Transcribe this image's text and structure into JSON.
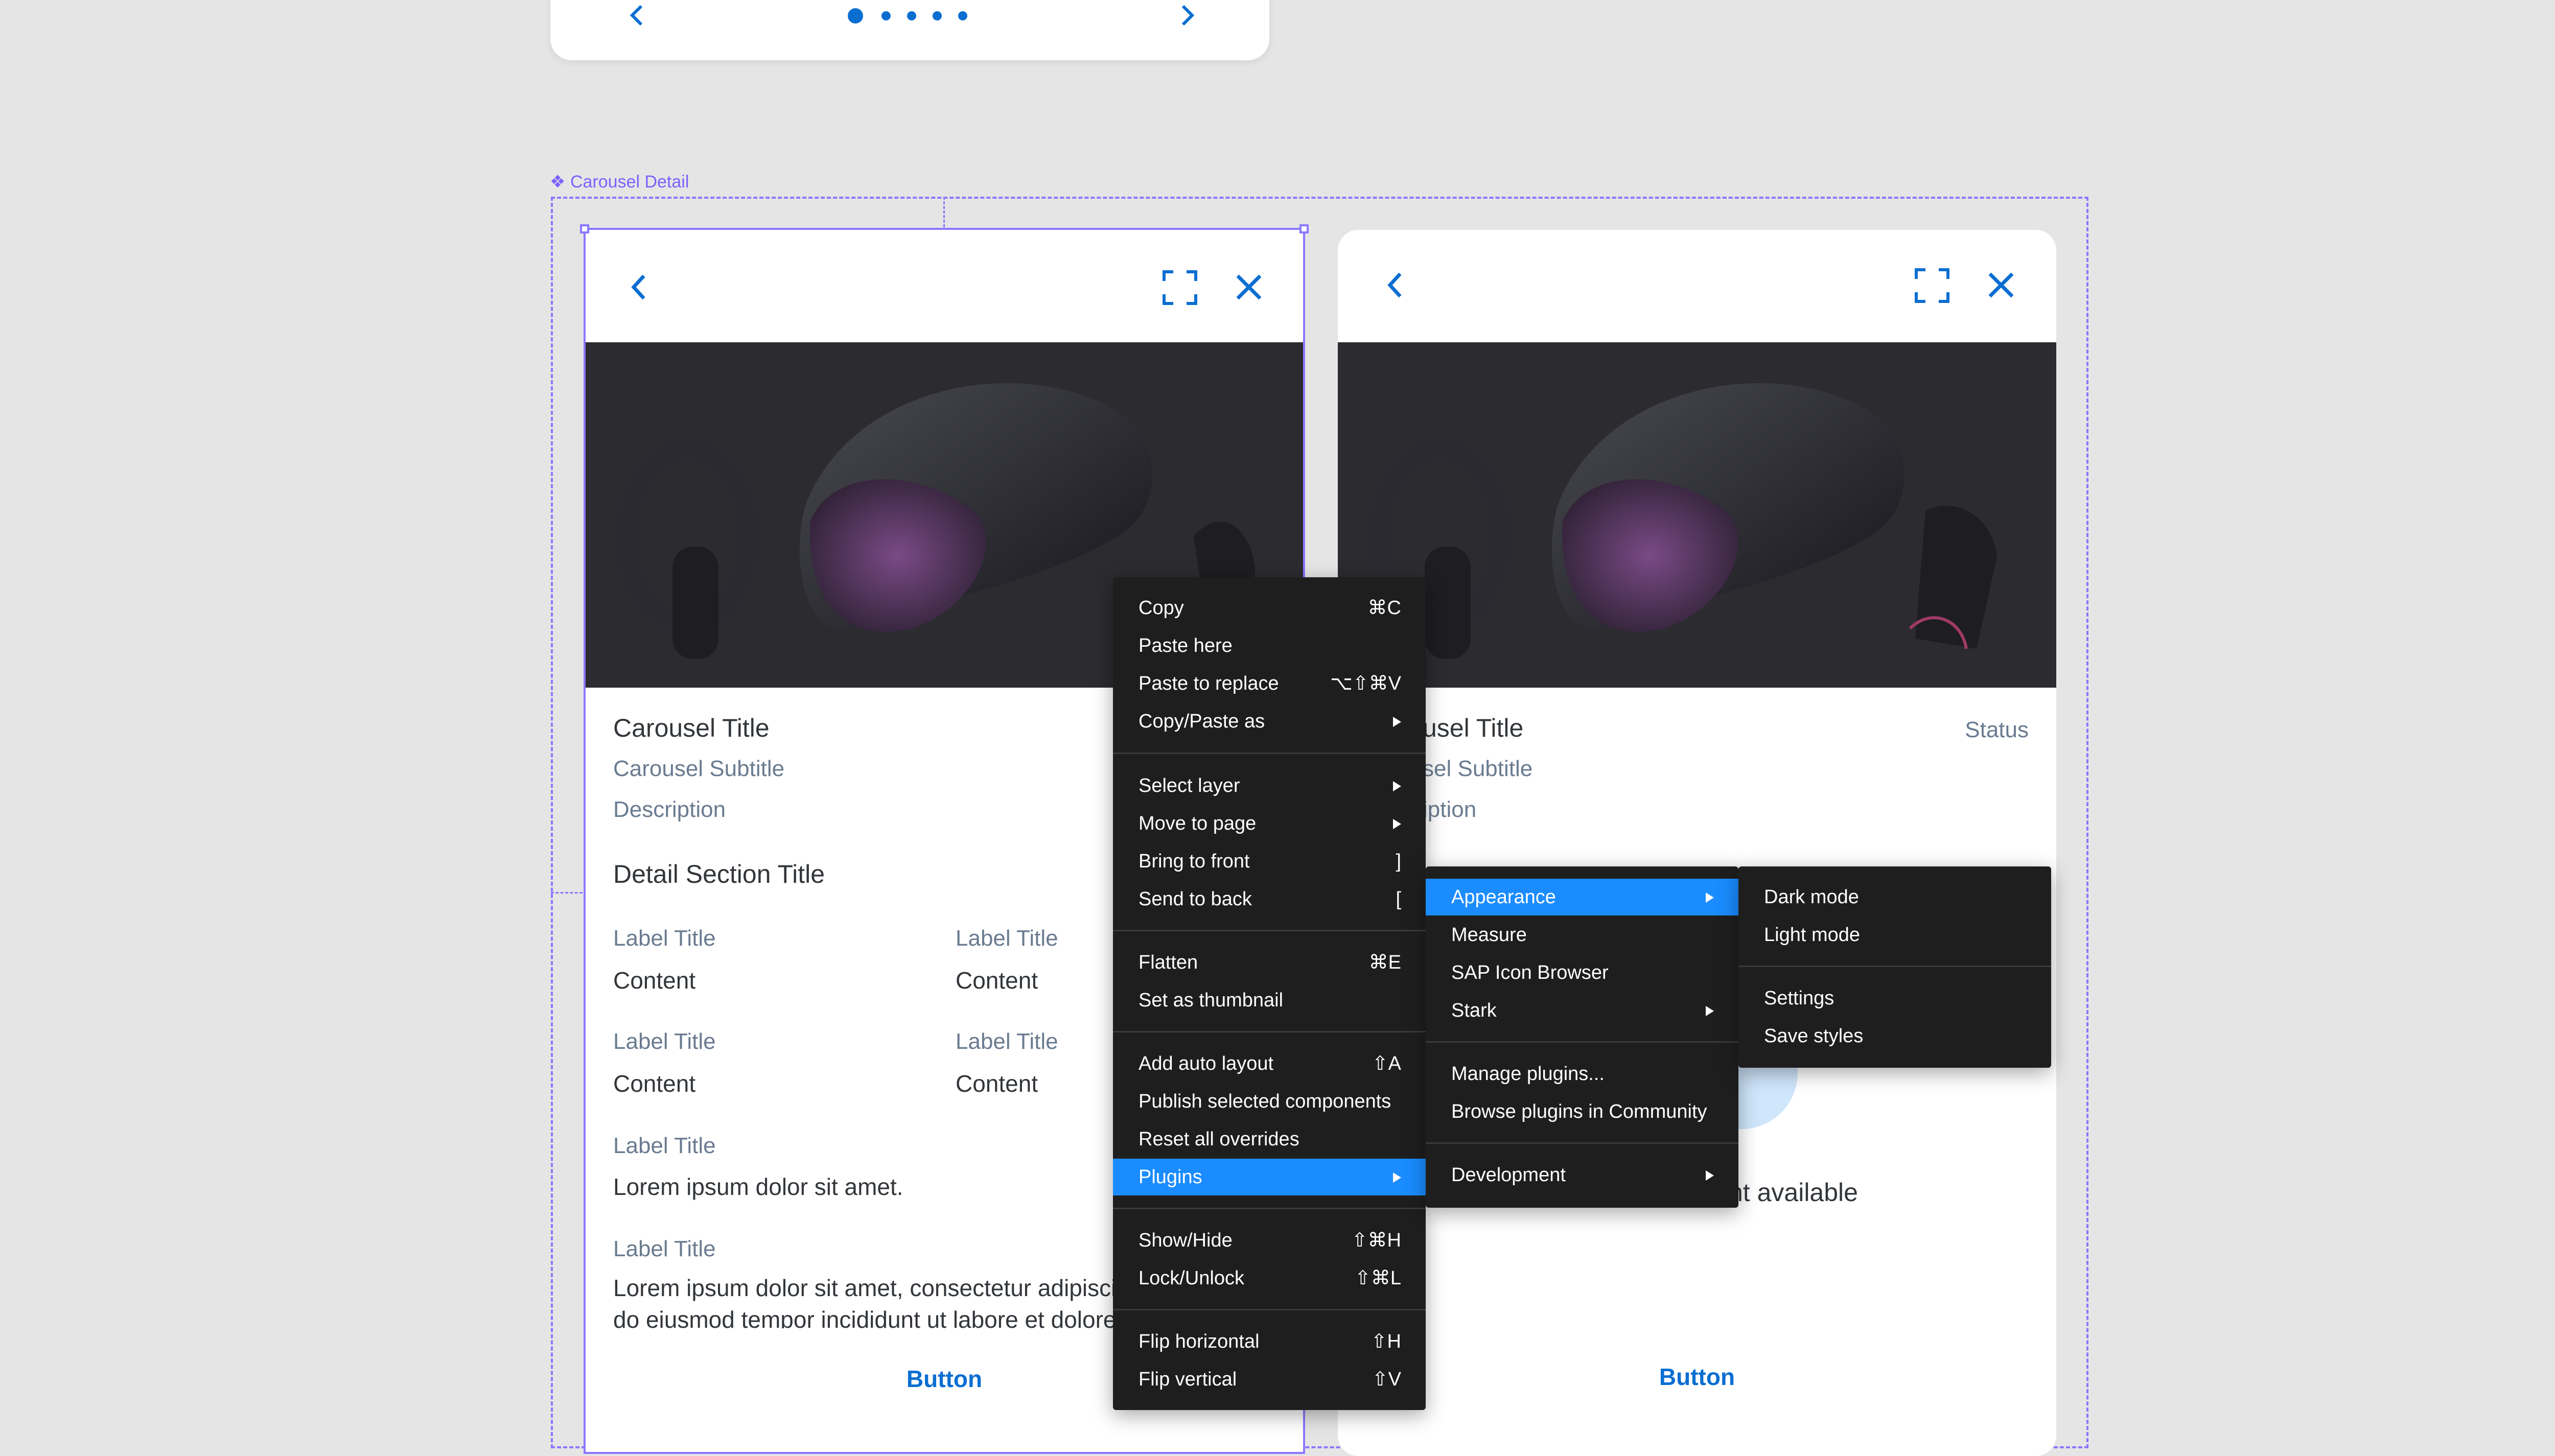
{
  "frame_label": "Carousel Detail",
  "card_left": {
    "title": "Carousel Title",
    "subtitle": "Carousel Subtitle",
    "description": "Description",
    "section_title": "Detail Section Title",
    "fields": [
      {
        "label": "Label Title",
        "content": "Content"
      },
      {
        "label": "Label Title",
        "content": "Content"
      },
      {
        "label": "Label Title",
        "content": "Content"
      },
      {
        "label": "Label Title",
        "content": "Content"
      },
      {
        "label": "Label Title",
        "content": "Lorem ipsum dolor sit amet."
      },
      {
        "label": "Label Title",
        "content": "Lorem ipsum dolor sit amet, consectetur adipiscing elit, sed",
        "content2": "do eiusmod tempor incididunt ut labore et dolore"
      }
    ],
    "button": "Button"
  },
  "card_right": {
    "title": "usel Title",
    "subtitle": "sel Subtitle",
    "description": "iption",
    "status": "Status",
    "empty_text": "nt available",
    "button": "Button"
  },
  "context_menu": {
    "items": [
      {
        "label": "Copy",
        "shortcut": "⌘C"
      },
      {
        "label": "Paste here",
        "shortcut": ""
      },
      {
        "label": "Paste to replace",
        "shortcut": "⌥⇧⌘V"
      },
      {
        "label": "Copy/Paste as",
        "shortcut": ""
      },
      {
        "label": "Select layer",
        "shortcut": ""
      },
      {
        "label": "Move to page",
        "shortcut": ""
      },
      {
        "label": "Bring to front",
        "shortcut": "]"
      },
      {
        "label": "Send to back",
        "shortcut": "["
      },
      {
        "label": "Flatten",
        "shortcut": "⌘E"
      },
      {
        "label": "Set as thumbnail",
        "shortcut": ""
      },
      {
        "label": "Add auto layout",
        "shortcut": "⇧A"
      },
      {
        "label": "Publish selected components",
        "shortcut": ""
      },
      {
        "label": "Reset all overrides",
        "shortcut": ""
      },
      {
        "label": "Plugins",
        "shortcut": ""
      },
      {
        "label": "Show/Hide",
        "shortcut": "⇧⌘H"
      },
      {
        "label": "Lock/Unlock",
        "shortcut": "⇧⌘L"
      },
      {
        "label": "Flip horizontal",
        "shortcut": "⇧H"
      },
      {
        "label": "Flip vertical",
        "shortcut": "⇧V"
      }
    ]
  },
  "plugins_menu": {
    "items": [
      "Appearance",
      "Measure",
      "SAP Icon Browser",
      "Stark",
      "Manage plugins...",
      "Browse plugins in Community",
      "Development"
    ]
  },
  "appearance_menu": {
    "items": [
      "Dark mode",
      "Light mode",
      "Settings",
      "Save styles"
    ]
  },
  "colors": {
    "accent": "#0a6ed1",
    "selection": "#8a78ff",
    "menu_bg": "#1e1e1e",
    "menu_highlight": "#1a8cff"
  }
}
